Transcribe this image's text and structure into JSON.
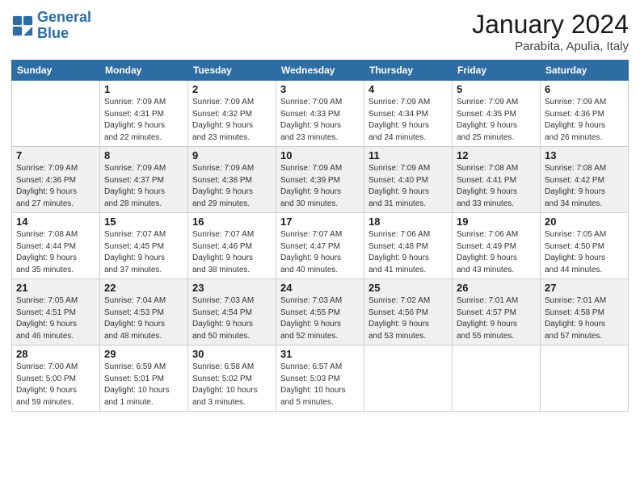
{
  "logo": {
    "line1": "General",
    "line2": "Blue"
  },
  "title": "January 2024",
  "location": "Parabita, Apulia, Italy",
  "days_of_week": [
    "Sunday",
    "Monday",
    "Tuesday",
    "Wednesday",
    "Thursday",
    "Friday",
    "Saturday"
  ],
  "weeks": [
    [
      {
        "day": "",
        "info": ""
      },
      {
        "day": "1",
        "info": "Sunrise: 7:09 AM\nSunset: 4:31 PM\nDaylight: 9 hours\nand 22 minutes."
      },
      {
        "day": "2",
        "info": "Sunrise: 7:09 AM\nSunset: 4:32 PM\nDaylight: 9 hours\nand 23 minutes."
      },
      {
        "day": "3",
        "info": "Sunrise: 7:09 AM\nSunset: 4:33 PM\nDaylight: 9 hours\nand 23 minutes."
      },
      {
        "day": "4",
        "info": "Sunrise: 7:09 AM\nSunset: 4:34 PM\nDaylight: 9 hours\nand 24 minutes."
      },
      {
        "day": "5",
        "info": "Sunrise: 7:09 AM\nSunset: 4:35 PM\nDaylight: 9 hours\nand 25 minutes."
      },
      {
        "day": "6",
        "info": "Sunrise: 7:09 AM\nSunset: 4:36 PM\nDaylight: 9 hours\nand 26 minutes."
      }
    ],
    [
      {
        "day": "7",
        "info": "Sunrise: 7:09 AM\nSunset: 4:36 PM\nDaylight: 9 hours\nand 27 minutes."
      },
      {
        "day": "8",
        "info": "Sunrise: 7:09 AM\nSunset: 4:37 PM\nDaylight: 9 hours\nand 28 minutes."
      },
      {
        "day": "9",
        "info": "Sunrise: 7:09 AM\nSunset: 4:38 PM\nDaylight: 9 hours\nand 29 minutes."
      },
      {
        "day": "10",
        "info": "Sunrise: 7:09 AM\nSunset: 4:39 PM\nDaylight: 9 hours\nand 30 minutes."
      },
      {
        "day": "11",
        "info": "Sunrise: 7:09 AM\nSunset: 4:40 PM\nDaylight: 9 hours\nand 31 minutes."
      },
      {
        "day": "12",
        "info": "Sunrise: 7:08 AM\nSunset: 4:41 PM\nDaylight: 9 hours\nand 33 minutes."
      },
      {
        "day": "13",
        "info": "Sunrise: 7:08 AM\nSunset: 4:42 PM\nDaylight: 9 hours\nand 34 minutes."
      }
    ],
    [
      {
        "day": "14",
        "info": "Sunrise: 7:08 AM\nSunset: 4:44 PM\nDaylight: 9 hours\nand 35 minutes."
      },
      {
        "day": "15",
        "info": "Sunrise: 7:07 AM\nSunset: 4:45 PM\nDaylight: 9 hours\nand 37 minutes."
      },
      {
        "day": "16",
        "info": "Sunrise: 7:07 AM\nSunset: 4:46 PM\nDaylight: 9 hours\nand 38 minutes."
      },
      {
        "day": "17",
        "info": "Sunrise: 7:07 AM\nSunset: 4:47 PM\nDaylight: 9 hours\nand 40 minutes."
      },
      {
        "day": "18",
        "info": "Sunrise: 7:06 AM\nSunset: 4:48 PM\nDaylight: 9 hours\nand 41 minutes."
      },
      {
        "day": "19",
        "info": "Sunrise: 7:06 AM\nSunset: 4:49 PM\nDaylight: 9 hours\nand 43 minutes."
      },
      {
        "day": "20",
        "info": "Sunrise: 7:05 AM\nSunset: 4:50 PM\nDaylight: 9 hours\nand 44 minutes."
      }
    ],
    [
      {
        "day": "21",
        "info": "Sunrise: 7:05 AM\nSunset: 4:51 PM\nDaylight: 9 hours\nand 46 minutes."
      },
      {
        "day": "22",
        "info": "Sunrise: 7:04 AM\nSunset: 4:53 PM\nDaylight: 9 hours\nand 48 minutes."
      },
      {
        "day": "23",
        "info": "Sunrise: 7:03 AM\nSunset: 4:54 PM\nDaylight: 9 hours\nand 50 minutes."
      },
      {
        "day": "24",
        "info": "Sunrise: 7:03 AM\nSunset: 4:55 PM\nDaylight: 9 hours\nand 52 minutes."
      },
      {
        "day": "25",
        "info": "Sunrise: 7:02 AM\nSunset: 4:56 PM\nDaylight: 9 hours\nand 53 minutes."
      },
      {
        "day": "26",
        "info": "Sunrise: 7:01 AM\nSunset: 4:57 PM\nDaylight: 9 hours\nand 55 minutes."
      },
      {
        "day": "27",
        "info": "Sunrise: 7:01 AM\nSunset: 4:58 PM\nDaylight: 9 hours\nand 57 minutes."
      }
    ],
    [
      {
        "day": "28",
        "info": "Sunrise: 7:00 AM\nSunset: 5:00 PM\nDaylight: 9 hours\nand 59 minutes."
      },
      {
        "day": "29",
        "info": "Sunrise: 6:59 AM\nSunset: 5:01 PM\nDaylight: 10 hours\nand 1 minute."
      },
      {
        "day": "30",
        "info": "Sunrise: 6:58 AM\nSunset: 5:02 PM\nDaylight: 10 hours\nand 3 minutes."
      },
      {
        "day": "31",
        "info": "Sunrise: 6:57 AM\nSunset: 5:03 PM\nDaylight: 10 hours\nand 5 minutes."
      },
      {
        "day": "",
        "info": ""
      },
      {
        "day": "",
        "info": ""
      },
      {
        "day": "",
        "info": ""
      }
    ]
  ]
}
